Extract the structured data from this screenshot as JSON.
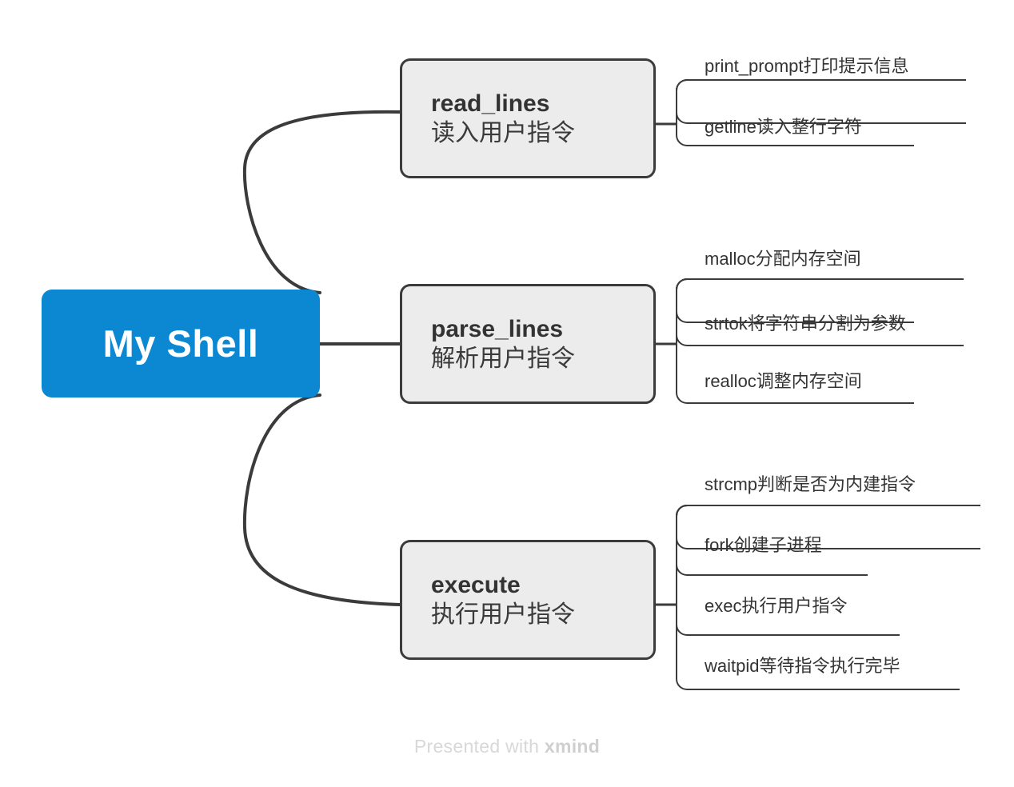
{
  "root": {
    "label": "My Shell",
    "color": "#0c87d2",
    "text_color": "#ffffff"
  },
  "branches": [
    {
      "title": "read_lines",
      "subtitle": "读入用户指令",
      "fill": "#ececec",
      "border": "#3b3b3b",
      "leaves": [
        {
          "label": "print_prompt打印提示信息"
        },
        {
          "label": "getline读入整行字符"
        }
      ]
    },
    {
      "title": "parse_lines",
      "subtitle": "解析用户指令",
      "fill": "#ececec",
      "border": "#3b3b3b",
      "leaves": [
        {
          "label": "malloc分配内存空间"
        },
        {
          "label": "strtok将字符串分割为参数"
        },
        {
          "label": "realloc调整内存空间"
        }
      ]
    },
    {
      "title": "execute",
      "subtitle": "执行用户指令",
      "fill": "#ececec",
      "border": "#3b3b3b",
      "leaves": [
        {
          "label": "strcmp判断是否为内建指令"
        },
        {
          "label": "fork创建子进程"
        },
        {
          "label": "exec执行用户指令"
        },
        {
          "label": "waitpid等待指令执行完毕"
        }
      ]
    }
  ],
  "footer": {
    "prefix": "Presented with ",
    "brand": "xmind"
  }
}
